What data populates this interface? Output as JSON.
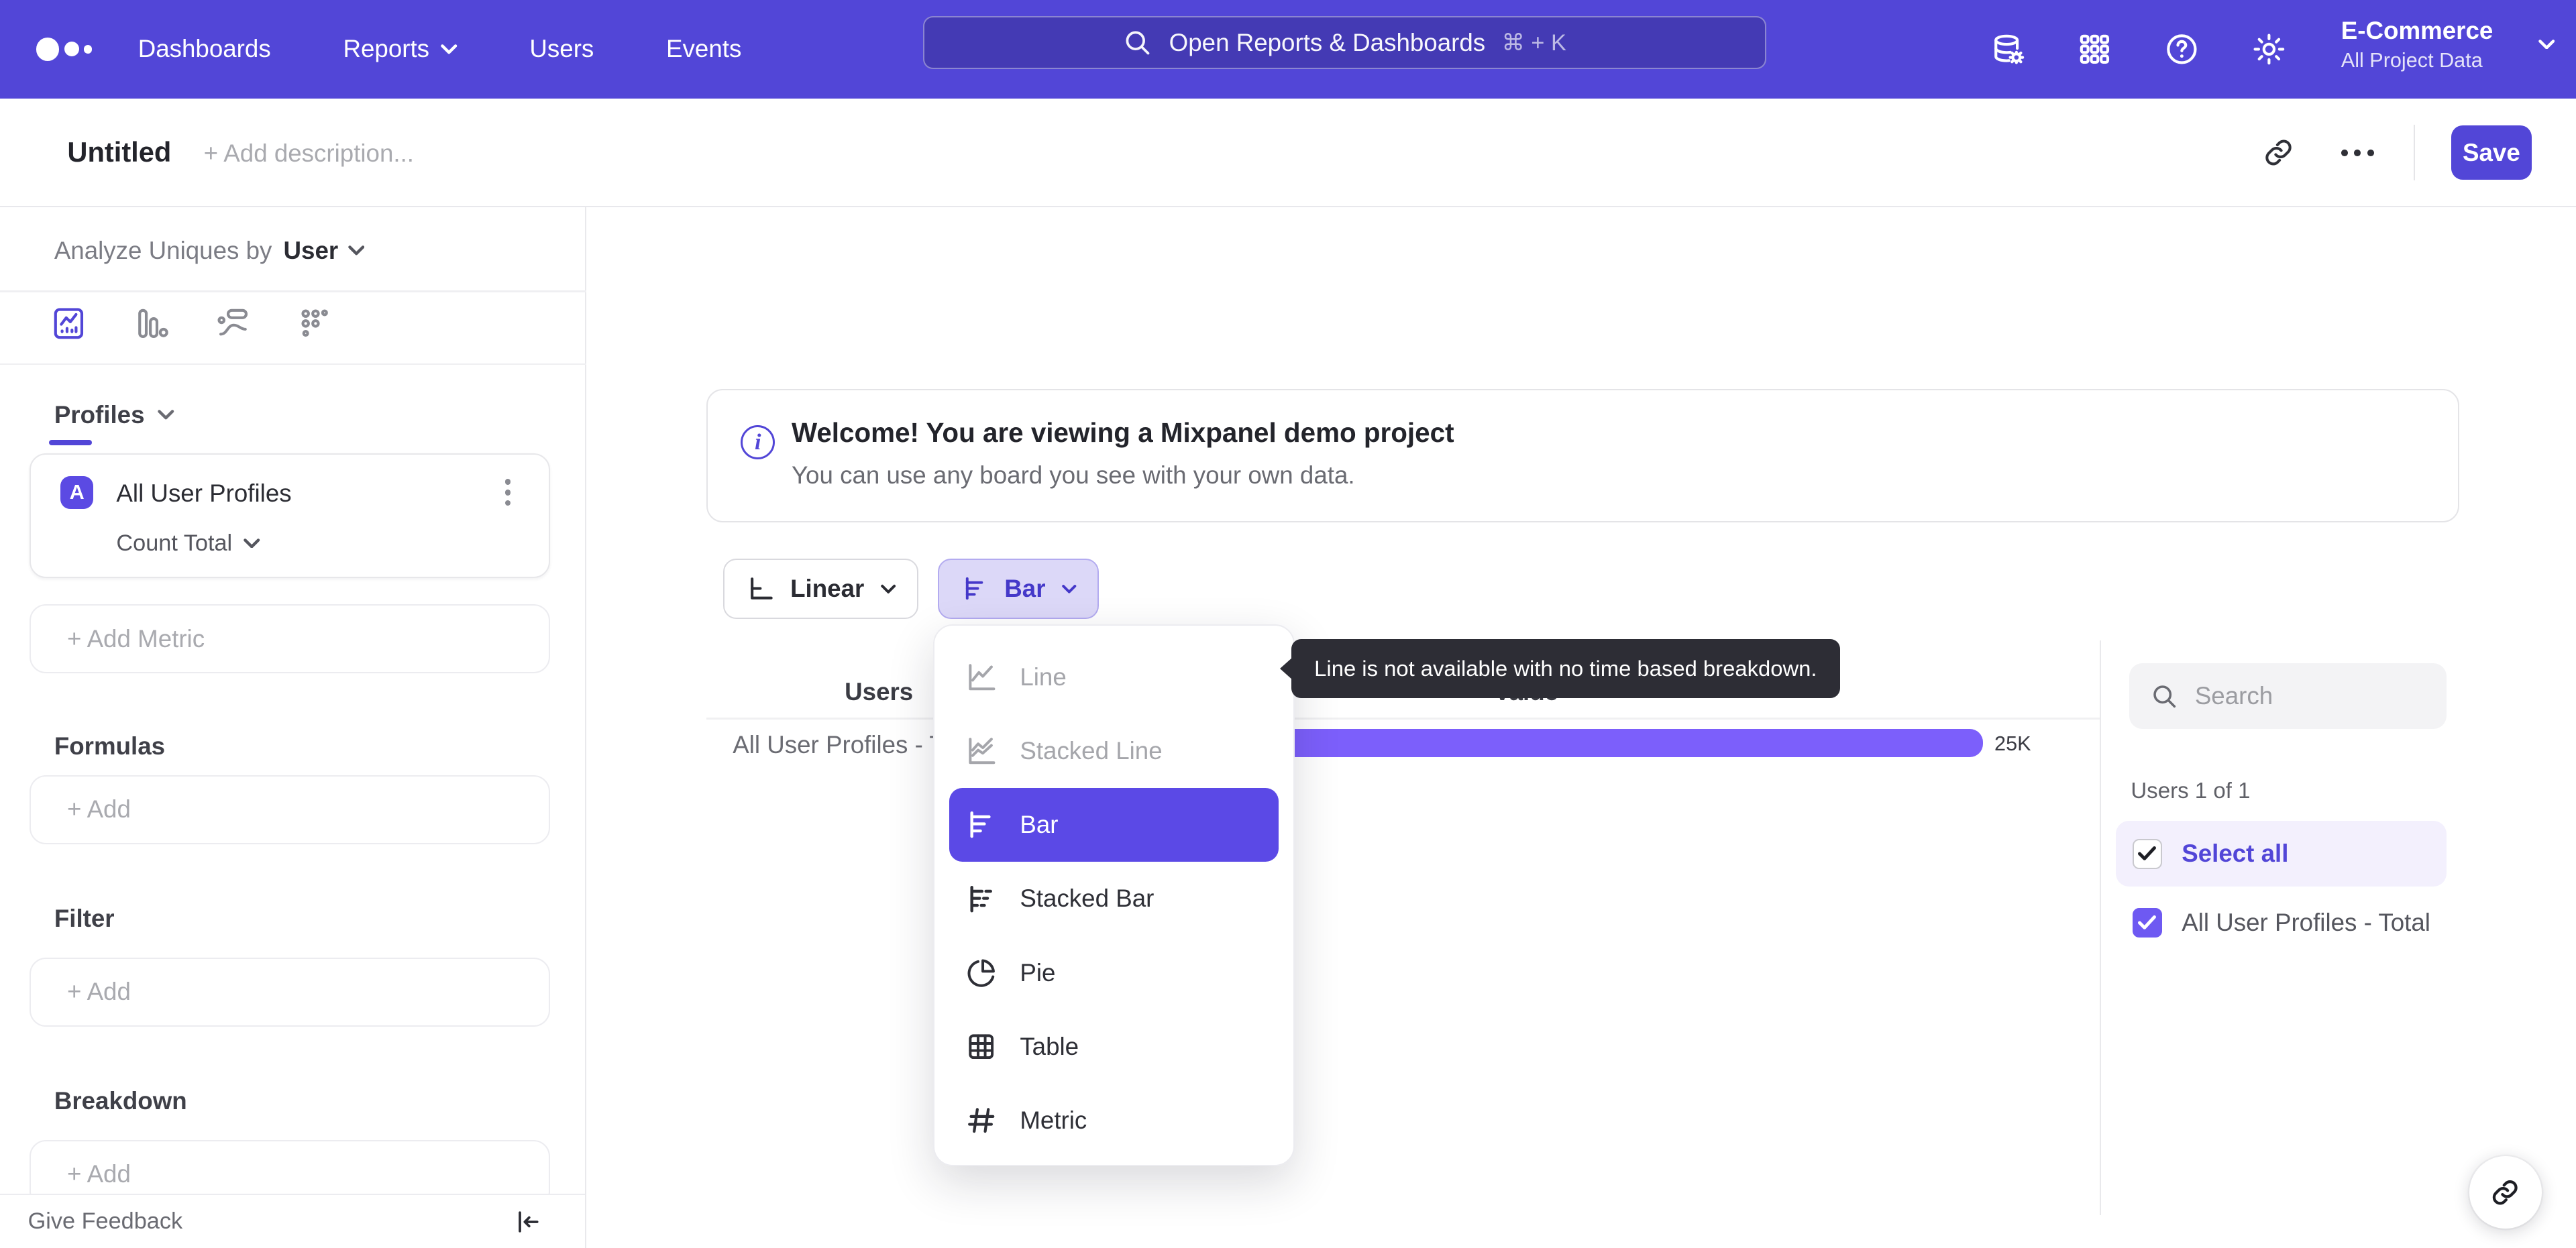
{
  "navbar": {
    "links": [
      "Dashboards",
      "Reports",
      "Users",
      "Events"
    ],
    "search_placeholder": "Open Reports & Dashboards",
    "search_shortcut": "⌘ + K",
    "project_name": "E-Commerce",
    "project_scope": "All Project Data"
  },
  "header": {
    "title": "Untitled",
    "description_placeholder": "+ Add description...",
    "save_label": "Save"
  },
  "sidebar": {
    "analyze_label": "Analyze Uniques by",
    "analyze_value": "User",
    "profiles_label": "Profiles",
    "metric": {
      "badge": "A",
      "name": "All User Profiles",
      "aggregation": "Count Total"
    },
    "add_metric_label": "+ Add Metric",
    "formulas_label": "Formulas",
    "filter_label": "Filter",
    "breakdown_label": "Breakdown",
    "add_label": "+ Add",
    "give_feedback": "Give Feedback"
  },
  "banner": {
    "title": "Welcome! You are viewing a Mixpanel demo project",
    "subtitle": "You can use any board you see with your own data."
  },
  "controls": {
    "scale": "Linear",
    "chart_type": "Bar"
  },
  "chart_menu": {
    "items": [
      {
        "label": "Line",
        "state": "disabled"
      },
      {
        "label": "Stacked Line",
        "state": "disabled"
      },
      {
        "label": "Bar",
        "state": "selected"
      },
      {
        "label": "Stacked Bar",
        "state": "normal"
      },
      {
        "label": "Pie",
        "state": "normal"
      },
      {
        "label": "Table",
        "state": "normal"
      },
      {
        "label": "Metric",
        "state": "normal"
      }
    ]
  },
  "tooltip": {
    "text": "Line is not available with no time based breakdown."
  },
  "chart": {
    "col_users": "Users",
    "col_value": "Value",
    "row_label": "All User Profiles - T",
    "value_label": "25K"
  },
  "chart_data": {
    "type": "bar",
    "orientation": "horizontal",
    "categories": [
      "All User Profiles - Total"
    ],
    "values": [
      25000
    ],
    "value_labels": [
      "25K"
    ],
    "series_color": "#7c5ffb",
    "columns": [
      "Users",
      "Value"
    ]
  },
  "legend": {
    "search_placeholder": "Search",
    "count_label": "Users 1 of 1",
    "select_all_label": "Select all",
    "items": [
      {
        "label": "All User Profiles - Total",
        "checked": true
      }
    ]
  },
  "colors": {
    "brand": "#5246d7",
    "bar_fill": "#7c5ffb",
    "menu_selected": "#5b49e6",
    "tooltip_bg": "#2d2d35"
  }
}
